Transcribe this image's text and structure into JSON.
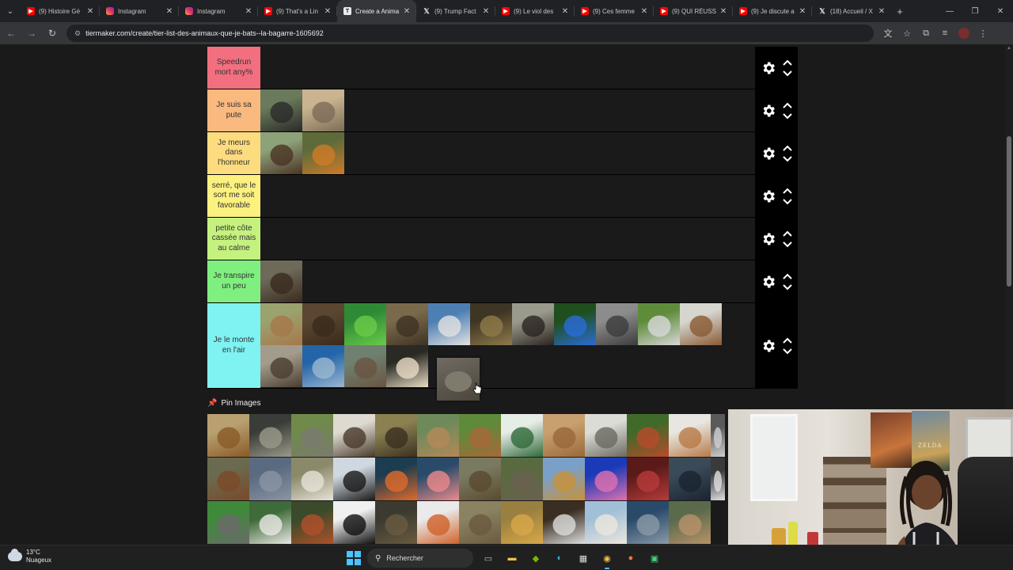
{
  "browser": {
    "tabs": [
      {
        "label": "(9) Histoire Gé",
        "icon": "youtube-icon",
        "active": false
      },
      {
        "label": "Instagram",
        "icon": "instagram-icon",
        "active": false
      },
      {
        "label": "Instagram",
        "icon": "instagram-icon",
        "active": false
      },
      {
        "label": "(9) That's a Lin",
        "icon": "youtube-icon",
        "active": false
      },
      {
        "label": "Create a Anima",
        "icon": "tiermaker-icon",
        "active": true
      },
      {
        "label": "(9) Trump Fact",
        "icon": "x-icon",
        "active": false
      },
      {
        "label": "(9) Le viol des",
        "icon": "youtube-icon",
        "active": false
      },
      {
        "label": "(9) Ces femme",
        "icon": "youtube-icon",
        "active": false
      },
      {
        "label": "(9) QUI RÉUSS",
        "icon": "youtube-icon",
        "active": false
      },
      {
        "label": "(9) Je discute a",
        "icon": "youtube-icon",
        "active": false
      },
      {
        "label": "(18) Accueil / X",
        "icon": "x-icon",
        "active": false
      }
    ],
    "url": "tiermaker.com/create/tier-list-des-animaux-que-je-bats--la-bagarre-1605692"
  },
  "tiers": [
    {
      "label": "Speedrun mort any%",
      "color": "#f26f7f",
      "items": []
    },
    {
      "label": "Je suis sa pute",
      "color": "#f9b97f",
      "items": [
        {
          "name": "gorilla-image",
          "c1": "#6a7a5a",
          "c2": "#2a2a2a"
        },
        {
          "name": "elephant-image",
          "c1": "#c9b48f",
          "c2": "#7d6c58"
        }
      ]
    },
    {
      "label": "Je meurs dans l'honneur",
      "color": "#fddc7f",
      "items": [
        {
          "name": "bear-image",
          "c1": "#8ea27a",
          "c2": "#4a3424"
        },
        {
          "name": "tiger-image",
          "c1": "#5d6b3a",
          "c2": "#d07a28"
        }
      ]
    },
    {
      "label": "serré, que le sort me soit favorable",
      "color": "#fcf07f",
      "items": []
    },
    {
      "label": "petite côte cassée mais au calme",
      "color": "#c5f27f",
      "items": []
    },
    {
      "label": "Je transpire un peu",
      "color": "#7ff07f",
      "items": [
        {
          "name": "bison-image",
          "c1": "#6e6a5a",
          "c2": "#3a2a1e"
        }
      ]
    },
    {
      "label": "Je le monte en l'air",
      "color": "#7ff2f2",
      "items": [
        {
          "name": "kangaroo-image",
          "c1": "#9aa26e",
          "c2": "#a67848"
        },
        {
          "name": "beaver-image",
          "c1": "#5b4632",
          "c2": "#3a2a1a"
        },
        {
          "name": "iguana-image",
          "c1": "#2f8a36",
          "c2": "#6acb48"
        },
        {
          "name": "boar-image",
          "c1": "#7a6a4c",
          "c2": "#3e3222"
        },
        {
          "name": "seagull-image",
          "c1": "#4d7fb3",
          "c2": "#e2e2e2"
        },
        {
          "name": "python-image",
          "c1": "#3f3524",
          "c2": "#8f7a4a"
        },
        {
          "name": "chimpanzee-image",
          "c1": "#9a9a8c",
          "c2": "#2a2420"
        },
        {
          "name": "frog-image",
          "c1": "#1f4f1c",
          "c2": "#2a6cd8"
        },
        {
          "name": "raccoon-image",
          "c1": "#8c8c8c",
          "c2": "#3c3c3c"
        },
        {
          "name": "zebra-image",
          "c1": "#5f8c3a",
          "c2": "#d8d8d8"
        },
        {
          "name": "deer-image",
          "c1": "#d6d6cf",
          "c2": "#8a5a34"
        },
        {
          "name": "porcupine-image",
          "c1": "#a39c8c",
          "c2": "#4a3e30"
        },
        {
          "name": "dolphin-image",
          "c1": "#2464a8",
          "c2": "#9bb8d0"
        },
        {
          "name": "walrus-image",
          "c1": "#6f8070",
          "c2": "#6a5442"
        },
        {
          "name": "owl-image",
          "c1": "#2a2a24",
          "c2": "#e8dcc4"
        }
      ]
    }
  ],
  "dragging_item": {
    "name": "seal-image",
    "c1": "#7b756b",
    "c2": "#514a40"
  },
  "pin": {
    "label": "Pin Images"
  },
  "pool": [
    {
      "name": "lion-image",
      "c1": "#b8a070",
      "c2": "#8a5a28"
    },
    {
      "name": "crocodile-image",
      "c1": "#3a3c38",
      "c2": "#9a9a8a"
    },
    {
      "name": "donkey-image",
      "c1": "#6f8a4a",
      "c2": "#7a7a70"
    },
    {
      "name": "eagle-image",
      "c1": "#dedad2",
      "c2": "#4a3a2a"
    },
    {
      "name": "ostrich-image",
      "c1": "#8a8050",
      "c2": "#3a3020"
    },
    {
      "name": "camel-image",
      "c1": "#6f8a5a",
      "c2": "#b58858"
    },
    {
      "name": "fawn-image",
      "c1": "#5f8a3a",
      "c2": "#a8683a"
    },
    {
      "name": "duck-image",
      "c1": "#e6ece6",
      "c2": "#2f6a3a"
    },
    {
      "name": "capybara-image",
      "c1": "#c8a070",
      "c2": "#9a6838"
    },
    {
      "name": "rhino-image",
      "c1": "#dcdcd6",
      "c2": "#6a6a62"
    },
    {
      "name": "red-panda-image",
      "c1": "#3f6a2a",
      "c2": "#b84a2a"
    },
    {
      "name": "bulldog-image",
      "c1": "#e8e6e0",
      "c2": "#b87a48"
    },
    {
      "name": "partial-white-image",
      "c1": "#5a5a5a",
      "c2": "#cfcfcf"
    },
    {
      "name": "orangutan-sitting-image",
      "c1": "#6a6a50",
      "c2": "#7a4a28"
    },
    {
      "name": "cat-image",
      "c1": "#5a6a80",
      "c2": "#8a94a2"
    },
    {
      "name": "goat-image",
      "c1": "#8a8a6a",
      "c2": "#e6e2d8"
    },
    {
      "name": "penguin-image",
      "c1": "#cfd8e0",
      "c2": "#1a1a1a"
    },
    {
      "name": "starfish-image",
      "c1": "#1c3c50",
      "c2": "#e06a2a"
    },
    {
      "name": "flamingo-image",
      "c1": "#2a4a6a",
      "c2": "#ec8a8a"
    },
    {
      "name": "tortoise-image",
      "c1": "#7a7a60",
      "c2": "#5a4a30"
    },
    {
      "name": "anteater-image",
      "c1": "#5a6a40",
      "c2": "#6a6050"
    },
    {
      "name": "giraffe-image",
      "c1": "#7aa0c8",
      "c2": "#c8923a"
    },
    {
      "name": "jellyfish-image",
      "c1": "#1a3ab8",
      "c2": "#e070b0"
    },
    {
      "name": "octopus-image",
      "c1": "#5a1a1a",
      "c2": "#b83a3a"
    },
    {
      "name": "sea-lion-image",
      "c1": "#3a4a58",
      "c2": "#1a2430"
    },
    {
      "name": "partial-white2-image",
      "c1": "#3a3a3a",
      "c2": "#e0e0e0"
    },
    {
      "name": "otter-image",
      "c1": "#3f8a3a",
      "c2": "#6a6a6a"
    },
    {
      "name": "horse-image",
      "c1": "#3f6a3a",
      "c2": "#e8e8e4"
    },
    {
      "name": "orangutan-image",
      "c1": "#3a4a2a",
      "c2": "#b0502a"
    },
    {
      "name": "panda-image",
      "c1": "#f0f0f0",
      "c2": "#101010"
    },
    {
      "name": "kiwi-image",
      "c1": "#3a3a30",
      "c2": "#6a5a40"
    },
    {
      "name": "fox-image",
      "c1": "#eaeaea",
      "c2": "#d0622a"
    },
    {
      "name": "hyena-image",
      "c1": "#8a8260",
      "c2": "#6a5a40"
    },
    {
      "name": "cheetah-image",
      "c1": "#9a8040",
      "c2": "#d8a848"
    },
    {
      "name": "badger-image",
      "c1": "#3a2e22",
      "c2": "#dcdcdc"
    },
    {
      "name": "llama-image",
      "c1": "#a0c0d8",
      "c2": "#ece6dc"
    },
    {
      "name": "shark-image",
      "c1": "#2a4a6a",
      "c2": "#8a9aa8"
    },
    {
      "name": "cougar-image",
      "c1": "#5a6a4a",
      "c2": "#b8926a"
    }
  ],
  "taskbar": {
    "weather_temp": "13°C",
    "weather_desc": "Nuageux",
    "search_label": "Rechercher"
  },
  "webcam": {
    "poster_text": "ZELDA"
  }
}
